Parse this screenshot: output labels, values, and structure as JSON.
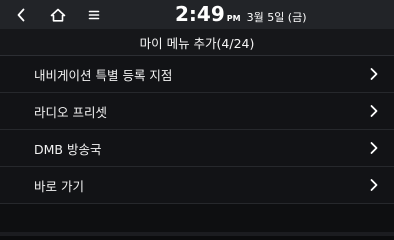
{
  "status_bar": {
    "time": "2:49",
    "ampm": "PM",
    "date": "3월 5일 (금)",
    "icons": [
      "back-icon",
      "home-icon",
      "menu-icon"
    ]
  },
  "header": {
    "title": "마이 메뉴 추가(4/24)"
  },
  "list": {
    "items": [
      {
        "label": "내비게이션 특별 등록 지점"
      },
      {
        "label": "라디오 프리셋"
      },
      {
        "label": "DMB 방송국"
      },
      {
        "label": "바로 가기"
      }
    ]
  },
  "colors": {
    "status_bar_bg": "#222428",
    "title_bg": "#16171a",
    "list_bg": "#121316",
    "divider": "#26282c",
    "text": "#f2f2f2"
  }
}
